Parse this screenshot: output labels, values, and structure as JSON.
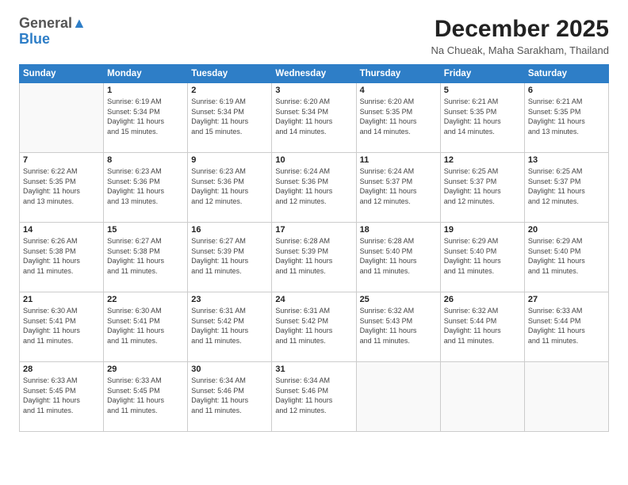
{
  "header": {
    "logo_general": "General",
    "logo_blue": "Blue",
    "month_year": "December 2025",
    "location": "Na Chueak, Maha Sarakham, Thailand"
  },
  "days_of_week": [
    "Sunday",
    "Monday",
    "Tuesday",
    "Wednesday",
    "Thursday",
    "Friday",
    "Saturday"
  ],
  "weeks": [
    [
      {
        "day": "",
        "info": ""
      },
      {
        "day": "1",
        "info": "Sunrise: 6:19 AM\nSunset: 5:34 PM\nDaylight: 11 hours\nand 15 minutes."
      },
      {
        "day": "2",
        "info": "Sunrise: 6:19 AM\nSunset: 5:34 PM\nDaylight: 11 hours\nand 15 minutes."
      },
      {
        "day": "3",
        "info": "Sunrise: 6:20 AM\nSunset: 5:34 PM\nDaylight: 11 hours\nand 14 minutes."
      },
      {
        "day": "4",
        "info": "Sunrise: 6:20 AM\nSunset: 5:35 PM\nDaylight: 11 hours\nand 14 minutes."
      },
      {
        "day": "5",
        "info": "Sunrise: 6:21 AM\nSunset: 5:35 PM\nDaylight: 11 hours\nand 14 minutes."
      },
      {
        "day": "6",
        "info": "Sunrise: 6:21 AM\nSunset: 5:35 PM\nDaylight: 11 hours\nand 13 minutes."
      }
    ],
    [
      {
        "day": "7",
        "info": "Sunrise: 6:22 AM\nSunset: 5:35 PM\nDaylight: 11 hours\nand 13 minutes."
      },
      {
        "day": "8",
        "info": "Sunrise: 6:23 AM\nSunset: 5:36 PM\nDaylight: 11 hours\nand 13 minutes."
      },
      {
        "day": "9",
        "info": "Sunrise: 6:23 AM\nSunset: 5:36 PM\nDaylight: 11 hours\nand 12 minutes."
      },
      {
        "day": "10",
        "info": "Sunrise: 6:24 AM\nSunset: 5:36 PM\nDaylight: 11 hours\nand 12 minutes."
      },
      {
        "day": "11",
        "info": "Sunrise: 6:24 AM\nSunset: 5:37 PM\nDaylight: 11 hours\nand 12 minutes."
      },
      {
        "day": "12",
        "info": "Sunrise: 6:25 AM\nSunset: 5:37 PM\nDaylight: 11 hours\nand 12 minutes."
      },
      {
        "day": "13",
        "info": "Sunrise: 6:25 AM\nSunset: 5:37 PM\nDaylight: 11 hours\nand 12 minutes."
      }
    ],
    [
      {
        "day": "14",
        "info": "Sunrise: 6:26 AM\nSunset: 5:38 PM\nDaylight: 11 hours\nand 11 minutes."
      },
      {
        "day": "15",
        "info": "Sunrise: 6:27 AM\nSunset: 5:38 PM\nDaylight: 11 hours\nand 11 minutes."
      },
      {
        "day": "16",
        "info": "Sunrise: 6:27 AM\nSunset: 5:39 PM\nDaylight: 11 hours\nand 11 minutes."
      },
      {
        "day": "17",
        "info": "Sunrise: 6:28 AM\nSunset: 5:39 PM\nDaylight: 11 hours\nand 11 minutes."
      },
      {
        "day": "18",
        "info": "Sunrise: 6:28 AM\nSunset: 5:40 PM\nDaylight: 11 hours\nand 11 minutes."
      },
      {
        "day": "19",
        "info": "Sunrise: 6:29 AM\nSunset: 5:40 PM\nDaylight: 11 hours\nand 11 minutes."
      },
      {
        "day": "20",
        "info": "Sunrise: 6:29 AM\nSunset: 5:40 PM\nDaylight: 11 hours\nand 11 minutes."
      }
    ],
    [
      {
        "day": "21",
        "info": "Sunrise: 6:30 AM\nSunset: 5:41 PM\nDaylight: 11 hours\nand 11 minutes."
      },
      {
        "day": "22",
        "info": "Sunrise: 6:30 AM\nSunset: 5:41 PM\nDaylight: 11 hours\nand 11 minutes."
      },
      {
        "day": "23",
        "info": "Sunrise: 6:31 AM\nSunset: 5:42 PM\nDaylight: 11 hours\nand 11 minutes."
      },
      {
        "day": "24",
        "info": "Sunrise: 6:31 AM\nSunset: 5:42 PM\nDaylight: 11 hours\nand 11 minutes."
      },
      {
        "day": "25",
        "info": "Sunrise: 6:32 AM\nSunset: 5:43 PM\nDaylight: 11 hours\nand 11 minutes."
      },
      {
        "day": "26",
        "info": "Sunrise: 6:32 AM\nSunset: 5:44 PM\nDaylight: 11 hours\nand 11 minutes."
      },
      {
        "day": "27",
        "info": "Sunrise: 6:33 AM\nSunset: 5:44 PM\nDaylight: 11 hours\nand 11 minutes."
      }
    ],
    [
      {
        "day": "28",
        "info": "Sunrise: 6:33 AM\nSunset: 5:45 PM\nDaylight: 11 hours\nand 11 minutes."
      },
      {
        "day": "29",
        "info": "Sunrise: 6:33 AM\nSunset: 5:45 PM\nDaylight: 11 hours\nand 11 minutes."
      },
      {
        "day": "30",
        "info": "Sunrise: 6:34 AM\nSunset: 5:46 PM\nDaylight: 11 hours\nand 11 minutes."
      },
      {
        "day": "31",
        "info": "Sunrise: 6:34 AM\nSunset: 5:46 PM\nDaylight: 11 hours\nand 12 minutes."
      },
      {
        "day": "",
        "info": ""
      },
      {
        "day": "",
        "info": ""
      },
      {
        "day": "",
        "info": ""
      }
    ]
  ]
}
